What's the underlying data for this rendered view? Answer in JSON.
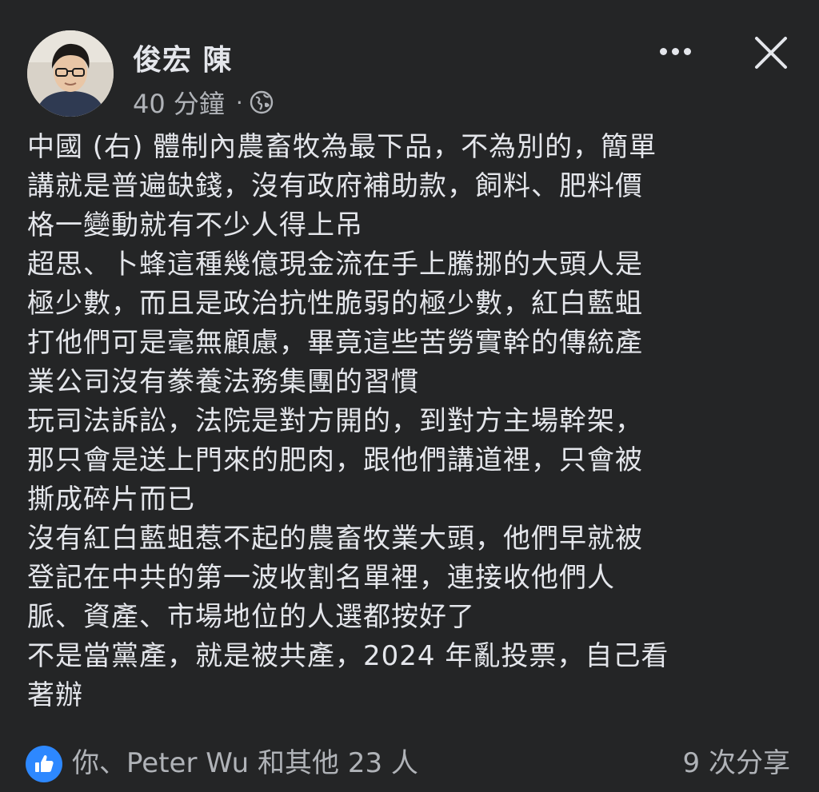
{
  "post": {
    "author": "俊宏 陳",
    "time": "40 分鐘",
    "separator": "·",
    "privacy_icon": "globe-icon",
    "text": "中國 (右) 體制內農畜牧為最下品，不為別的，簡單\n講就是普遍缺錢，沒有政府補助款，飼料、肥料價\n格一變動就有不少人得上吊\n超思、卜蜂這種幾億現金流在手上騰挪的大頭人是\n極少數，而且是政治抗性脆弱的極少數，紅白藍蛆\n打他們可是毫無顧慮，畢竟這些苦勞實幹的傳統產\n業公司沒有豢養法務集團的習慣\n玩司法訴訟，法院是對方開的，到對方主場幹架，\n那只會是送上門來的肥肉，跟他們講道裡，只會被\n撕成碎片而已\n沒有紅白藍蛆惹不起的農畜牧業大頭，他們早就被\n登記在中共的第一波收割名單裡，連接收他們人\n脈、資產、市場地位的人選都按好了\n不是當黨產，就是被共產，2024 年亂投票，自己看\n著辦"
  },
  "actions": {
    "more_icon": "more-horizontal-icon",
    "close_icon": "close-icon"
  },
  "footer": {
    "like_icon": "thumbs-up-icon",
    "reactors": "你、Peter Wu 和其他 23 人",
    "shares": "9 次分享"
  },
  "colors": {
    "background": "#242526",
    "text_primary": "#e4e6eb",
    "text_secondary": "#b0b3b8",
    "like_blue": "#2d88ff"
  }
}
